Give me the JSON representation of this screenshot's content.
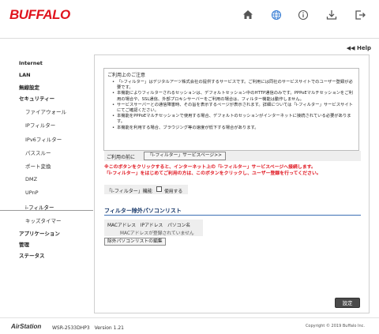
{
  "header": {
    "logo": "BUFFALO",
    "icons": [
      "home-icon",
      "globe-icon",
      "info-icon",
      "download-icon",
      "logout-icon"
    ],
    "colors": {
      "brand": "#e0141e",
      "active_icon": "#3a7fd5",
      "icon": "#555555"
    }
  },
  "help": {
    "label": "◀◀ Help"
  },
  "sidebar": {
    "items": [
      {
        "label": "Internet"
      },
      {
        "label": "LAN"
      },
      {
        "label": "無線設定"
      },
      {
        "label": "セキュリティー"
      },
      {
        "label": "ファイアウォール"
      },
      {
        "label": "IPフィルター"
      },
      {
        "label": "IPv6フィルター"
      },
      {
        "label": "パススルー"
      },
      {
        "label": "ポート変換"
      },
      {
        "label": "DMZ"
      },
      {
        "label": "UPnP"
      },
      {
        "label": "i-フィルター"
      },
      {
        "label": "キッズタイマー"
      },
      {
        "label": "アプリケーション"
      },
      {
        "label": "管理"
      },
      {
        "label": "ステータス"
      }
    ],
    "selected": "i-フィルター"
  },
  "notice": {
    "title": "ご利用上のご注意",
    "items": [
      "「i-フィルター」はデジタルアーツ株式会社の提供するサービスです。ご利用には同社のサービスサイトでのユーザー登録が必要です。",
      "本機能によりフィルターされるセッションは、デフォルトセッション中のHTTP通信のみです。PPPoEマルチセッションをご利用の場合や、SSL通信、外部プロキシサーバーをご利用の場合は、フィルター機能は動作しません。",
      "サービスサーバーとの通信障害時、その旨を表示するページが表示されます。詳細については「i-フィルター」サービスサイトにてご確認ください。",
      "本機能をPPPoEマルチセッションで使用する場合、デフォルトのセッションがインターネットに接続されている必要があります。",
      "本機能を利用する場合、ブラウジング等の速度が低下する場合があります。"
    ]
  },
  "service": {
    "before_label": "ご利用の前に",
    "button_label": "「i-フィルター」サービスページ>>"
  },
  "warning": {
    "line1": "※このボタンをクリックすると、インターネット上の「i-フィルター」サービスページへ接続します。",
    "line2": "「i-フィルター」をはじめてご利用の方は、このボタンをクリックし、ユーザー登録を行ってください。"
  },
  "function": {
    "label": "「i-フィルター」機能",
    "checkbox_label": "使用する"
  },
  "exclusion": {
    "title": "フィルター除外パソコンリスト",
    "columns": "MACアドレス　IPアドレス　パソコン名",
    "empty": "MACアドレスが登録されていません",
    "edit_button": "除外パソコンリストの編集"
  },
  "apply_button": "設定",
  "footer": {
    "brand": "AirStation",
    "model": "WSR-2533DHP3　Version 1.21",
    "copyright": "Copyright © 2019 Buffalo Inc."
  }
}
